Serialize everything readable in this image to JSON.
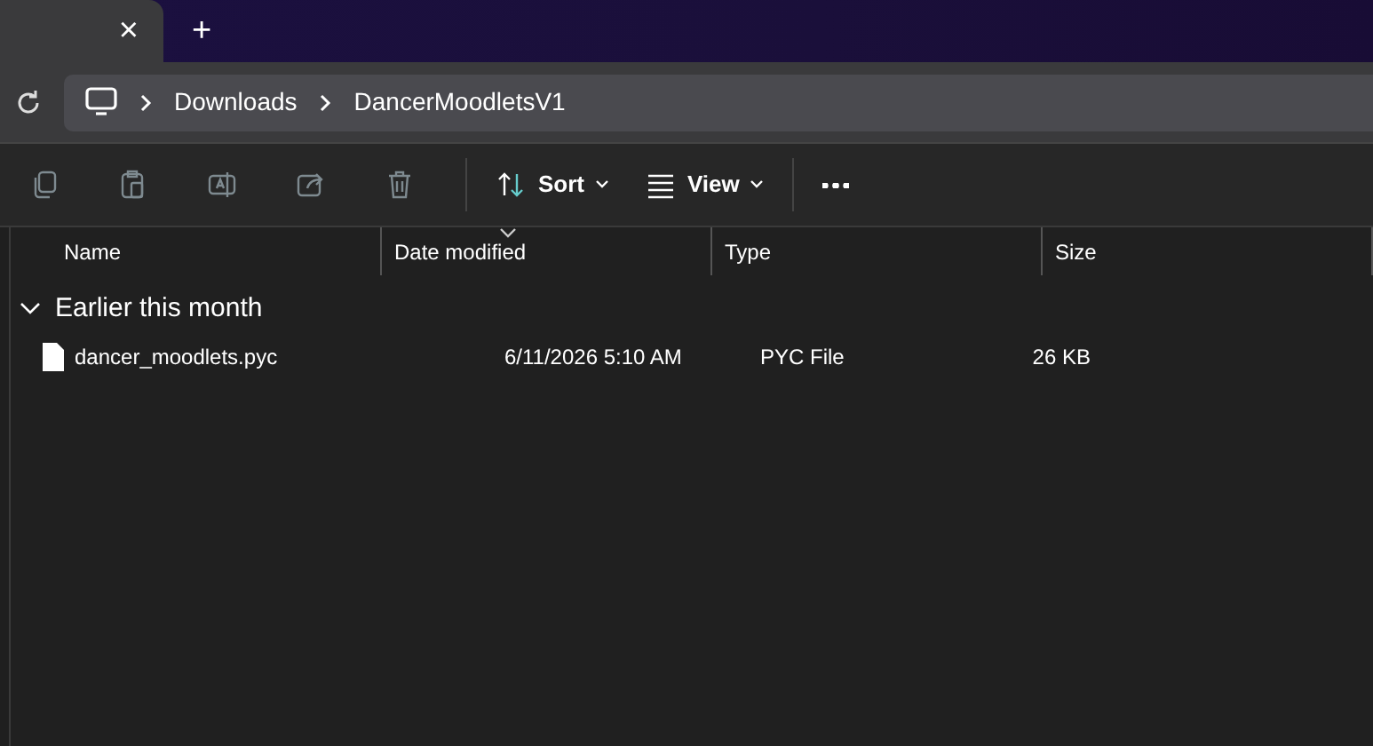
{
  "tab_bar": {
    "close_glyph": "×",
    "new_tab_glyph": "+"
  },
  "address_bar": {
    "breadcrumbs": [
      {
        "label": "Downloads"
      },
      {
        "label": "DancerMoodletsV1"
      }
    ]
  },
  "toolbar": {
    "buttons": [
      {
        "kind": "copy",
        "disabled": true
      },
      {
        "kind": "paste",
        "disabled": true
      },
      {
        "kind": "rename",
        "disabled": true
      },
      {
        "kind": "share",
        "disabled": true
      },
      {
        "kind": "delete",
        "disabled": true
      },
      {
        "kind": "sort",
        "label": "Sort",
        "disabled": false
      },
      {
        "kind": "view",
        "label": "View",
        "disabled": false
      },
      {
        "kind": "more",
        "disabled": false
      }
    ]
  },
  "table": {
    "columns": [
      {
        "label": "Name",
        "sorted": false
      },
      {
        "label": "Date modified",
        "sorted": true
      },
      {
        "label": "Type",
        "sorted": false
      },
      {
        "label": "Size",
        "sorted": false
      }
    ],
    "groups": [
      {
        "label": "Earlier this month",
        "expanded": true,
        "rows": [
          {
            "name": "dancer_moodlets.pyc",
            "date_modified": "6/11/2026 5:10 AM",
            "type": "PYC File",
            "size": "26 KB"
          }
        ]
      }
    ]
  }
}
